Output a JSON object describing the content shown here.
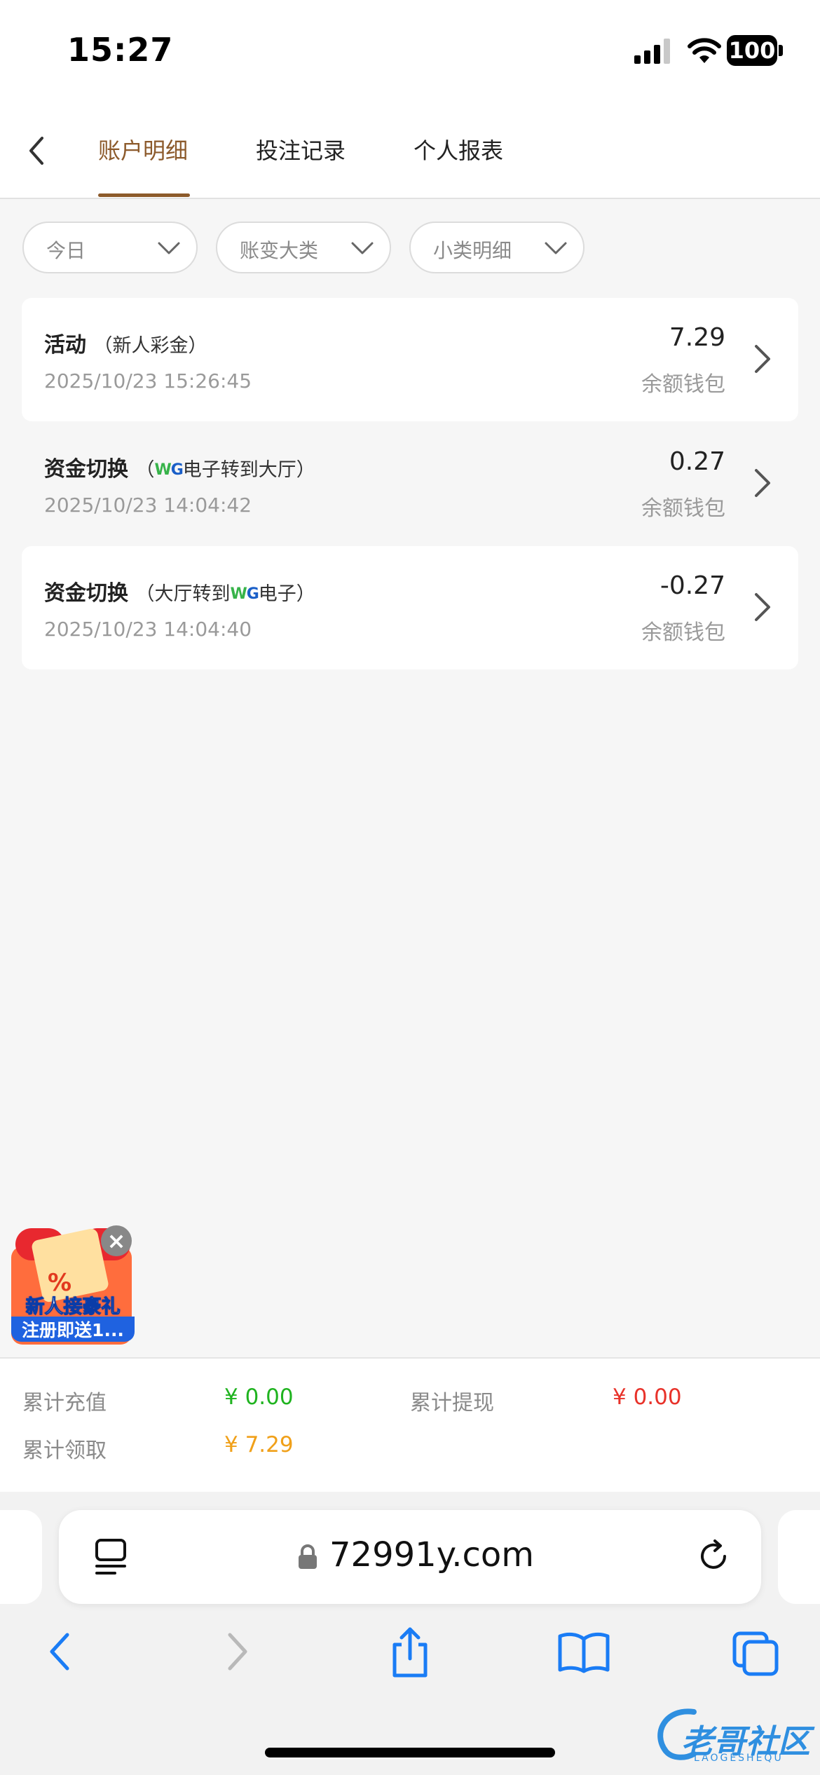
{
  "status_bar": {
    "time": "15:27",
    "battery": "100"
  },
  "header": {
    "tabs": [
      {
        "label": "账户明细",
        "active": true
      },
      {
        "label": "投注记录",
        "active": false
      },
      {
        "label": "个人报表",
        "active": false
      }
    ]
  },
  "filters": [
    {
      "value": "今日"
    },
    {
      "value": "账变大类"
    },
    {
      "value": "小类明细"
    }
  ],
  "records": [
    {
      "title": "活动",
      "detail_open": "（新人彩金）",
      "detail_pre": "",
      "detail_post": "",
      "date": "2025/10/23 15:26:45",
      "amount": "7.29",
      "wallet": "余额钱包"
    },
    {
      "title": "资金切换",
      "detail_pre": "（",
      "detail_post": "电子转到大厅）",
      "date": "2025/10/23 14:04:42",
      "amount": "0.27",
      "wallet": "余额钱包"
    },
    {
      "title": "资金切换",
      "detail_pre": "（大厅转到",
      "detail_post": "电子）",
      "date": "2025/10/23 14:04:40",
      "amount": "-0.27",
      "wallet": "余额钱包"
    }
  ],
  "brand_badge": {
    "w": "W",
    "g": "G"
  },
  "promo": {
    "line1": "新人接豪礼",
    "line2": "注册即送1...",
    "percent": "%"
  },
  "summary": {
    "recharge_label": "累计充值",
    "recharge_value": "¥ 0.00",
    "withdraw_label": "累计提现",
    "withdraw_value": "¥ 0.00",
    "claim_label": "累计领取",
    "claim_value": "¥ 7.29"
  },
  "browser": {
    "url": "72991y.com"
  },
  "watermark": {
    "text": "老哥社区",
    "sub": "LAOGESHEQU"
  },
  "colors": {
    "accent": "#8c5a2b",
    "green": "#1fb31f",
    "red": "#e8322a",
    "orange": "#f0a019",
    "ios_blue": "#1a7cf5"
  }
}
